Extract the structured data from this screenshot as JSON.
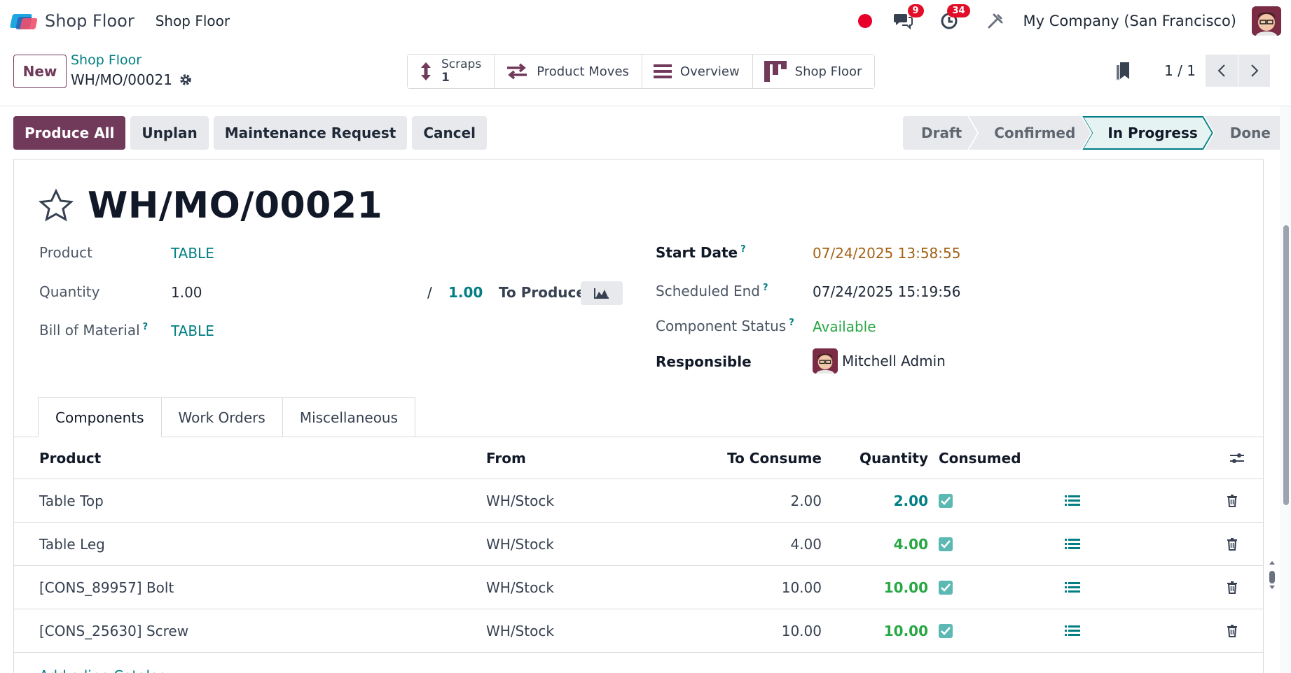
{
  "navbar": {
    "app_name": "Shop Floor",
    "menu_item": "Shop Floor",
    "chat_count": "9",
    "activity_count": "34",
    "company": "My Company (San Francisco)"
  },
  "control": {
    "new_label": "New",
    "breadcrumb": "Shop Floor",
    "record_name": "WH/MO/00021",
    "smart_buttons": {
      "scraps_label": "Scraps",
      "scraps_count": "1",
      "moves_label": "Product Moves",
      "overview_label": "Overview",
      "shopfloor_label": "Shop Floor"
    },
    "pager": "1 / 1"
  },
  "actions": {
    "produce_all": "Produce All",
    "unplan": "Unplan",
    "maintenance": "Maintenance Request",
    "cancel": "Cancel"
  },
  "statusbar": {
    "stages": [
      "Draft",
      "Confirmed",
      "In Progress",
      "Done"
    ],
    "active": "In Progress"
  },
  "form": {
    "title": "WH/MO/00021",
    "product_label": "Product",
    "product_value": "TABLE",
    "quantity_label": "Quantity",
    "quantity_value": "1.00",
    "qty_separator": "/",
    "quantity_target": "1.00",
    "to_produce_label": "To Produce",
    "bom_label": "Bill of Material",
    "bom_value": "TABLE",
    "help_mark": "?",
    "start_date_label": "Start Date",
    "start_date_value": "07/24/2025 13:58:55",
    "scheduled_end_label": "Scheduled End",
    "scheduled_end_value": "07/24/2025 15:19:56",
    "component_status_label": "Component Status",
    "component_status_value": "Available",
    "responsible_label": "Responsible",
    "responsible_value": "Mitchell Admin"
  },
  "tabs": [
    "Components",
    "Work Orders",
    "Miscellaneous"
  ],
  "components": {
    "headers": {
      "product": "Product",
      "from": "From",
      "to_consume": "To Consume",
      "quantity": "Quantity",
      "consumed": "Consumed"
    },
    "rows": [
      {
        "product": "Table Top",
        "from": "WH/Stock",
        "to_consume": "2.00",
        "quantity": "2.00",
        "qty_color": "#017e84"
      },
      {
        "product": "Table Leg",
        "from": "WH/Stock",
        "to_consume": "4.00",
        "quantity": "4.00",
        "qty_color": "#28a745"
      },
      {
        "product": "[CONS_89957] Bolt",
        "from": "WH/Stock",
        "to_consume": "10.00",
        "quantity": "10.00",
        "qty_color": "#28a745"
      },
      {
        "product": "[CONS_25630] Screw",
        "from": "WH/Stock",
        "to_consume": "10.00",
        "quantity": "10.00",
        "qty_color": "#28a745"
      }
    ],
    "add_line": "Add a line    Catalog"
  },
  "colors": {
    "primary": "#71395a",
    "link": "#017e84",
    "success": "#28a745",
    "warning": "#a46113"
  }
}
